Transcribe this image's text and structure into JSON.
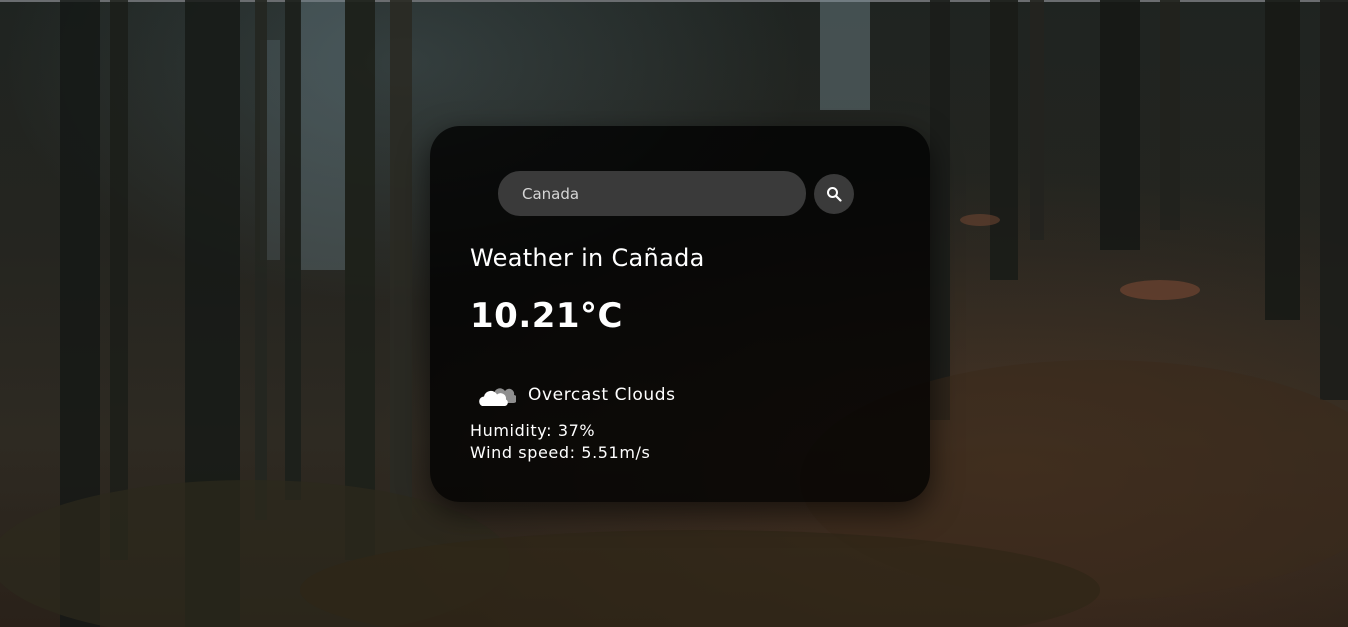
{
  "search": {
    "value": "Canada",
    "button_icon": "search-icon"
  },
  "weather": {
    "title": "Weather in Cañada",
    "temperature": "10.21°C",
    "condition_icon": "cloud-icon",
    "condition": "Overcast Clouds",
    "humidity": "Humidity: 37%",
    "wind": "Wind speed: 5.51m/s"
  },
  "colors": {
    "card_background": "#000000",
    "input_background": "#3a3a3a",
    "text": "#ffffff"
  }
}
